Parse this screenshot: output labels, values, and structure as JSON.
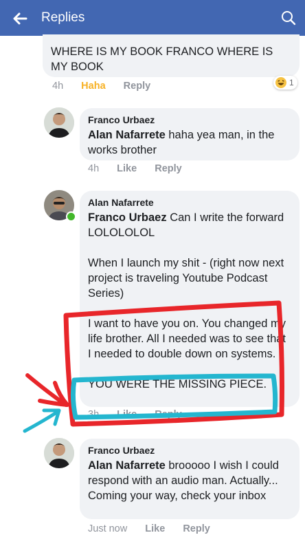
{
  "header": {
    "title": "Replies",
    "bg_color": "#4267b2"
  },
  "first_comment": {
    "text": "WHERE IS MY BOOK FRANCO WHERE IS MY BOOK",
    "time": "4h",
    "reaction_label": "Haha",
    "reply_label": "Reply",
    "reaction_count": "1"
  },
  "replies": [
    {
      "author": "Franco Urbaez",
      "mention": "Alan Nafarrete",
      "text": " haha yea man, in the works brother",
      "time": "4h",
      "like": "Like",
      "reply": "Reply"
    },
    {
      "author": "Alan Nafarrete",
      "mention": "Franco Urbaez",
      "text": " Can I write the forward LOLOLOLOL",
      "para2": "When I launch my shit - (right now next project is traveling Youtube Podcast Series)",
      "para3": "I want to have you on. You changed my life brother. All I needed was to see that I needed to double down on systems.",
      "para4": "YOU WERE THE MISSING PIECE.",
      "time": "3h",
      "like": "Like",
      "reply": "Reply"
    },
    {
      "author": "Franco Urbaez",
      "mention": "Alan Nafarrete",
      "text": " brooooo I wish I could respond with an audio man. Actually...  Coming your way, check your inbox",
      "time": "Just now",
      "like": "Like",
      "reply": "Reply"
    }
  ],
  "annotation_colors": {
    "red_box": "#e8262a",
    "cyan_box": "#24b6cf",
    "arrow": "#e8262a"
  }
}
